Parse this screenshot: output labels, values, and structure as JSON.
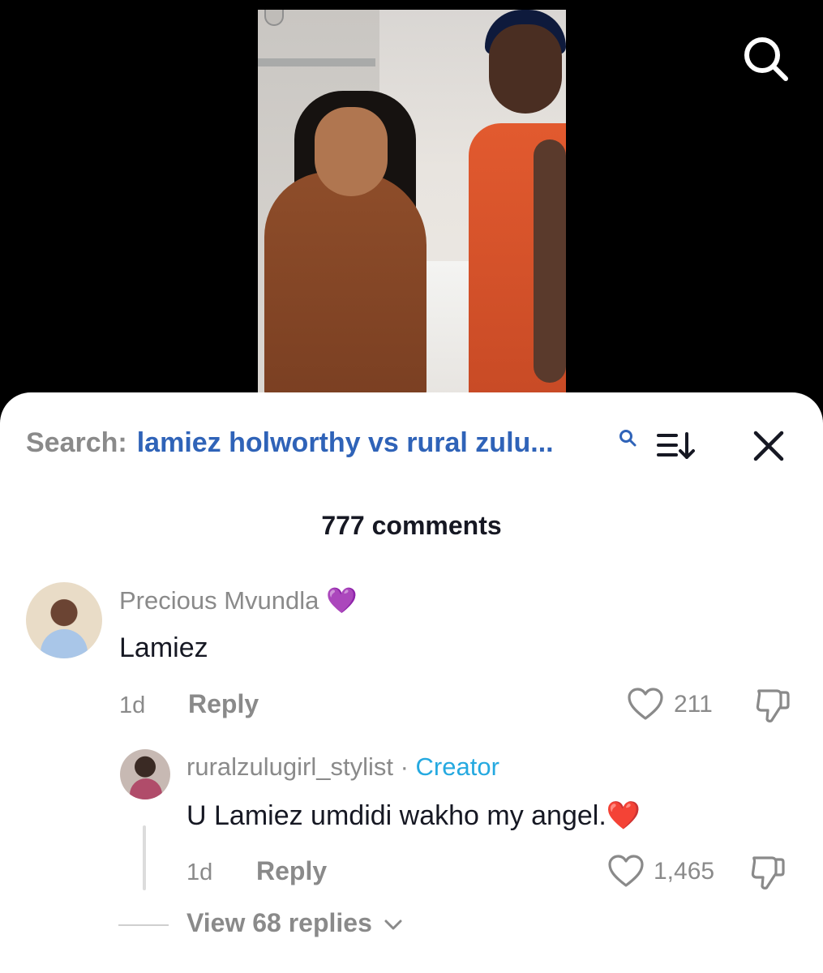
{
  "search": {
    "label": "Search:",
    "query": "lamiez holworthy vs rural zulu..."
  },
  "comments_header": {
    "count_label": "777 comments"
  },
  "comments": [
    {
      "username": "Precious Mvundla",
      "emoji": "💜",
      "text": "Lamiez",
      "time": "1d",
      "reply_label": "Reply",
      "likes": "211"
    }
  ],
  "replies": [
    {
      "username": "ruralzulugirl_stylist",
      "separator": "·",
      "badge": "Creator",
      "text": "U Lamiez umdidi wakho my angel.",
      "emoji": "❤️",
      "time": "1d",
      "reply_label": "Reply",
      "likes": "1,465"
    }
  ],
  "view_replies": {
    "label": "View 68 replies"
  },
  "colors": {
    "search_query": "#2f63b8",
    "creator_badge": "#25a9e0",
    "muted_text": "#8a8a8a",
    "primary_text": "#161823"
  },
  "icons": {
    "top_search": "search-icon",
    "inline_search": "search-icon",
    "sort": "sort-icon",
    "close": "close-icon",
    "like": "heart-icon",
    "dislike": "thumbs-down-icon",
    "expand": "chevron-down-icon"
  }
}
